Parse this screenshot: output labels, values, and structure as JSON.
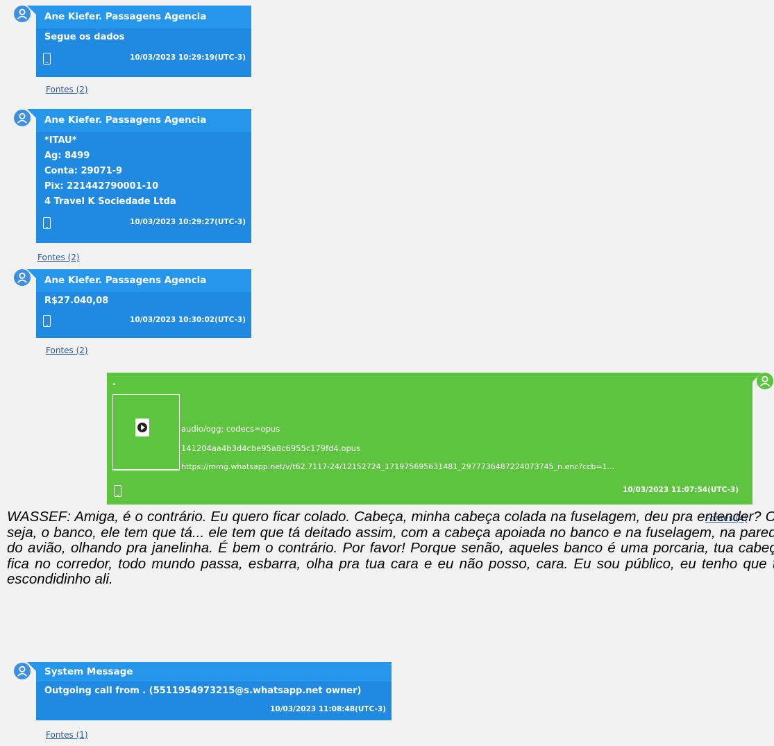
{
  "messages": [
    {
      "sender": "Ane Kiefer. Passagens Agencia",
      "lines": [
        "Segue os dados"
      ],
      "timestamp": "10/03/2023 10:29:19(UTC-3)",
      "sources": "Fontes (2)"
    },
    {
      "sender": "Ane Kiefer. Passagens Agencia",
      "lines": [
        "*ITAU*",
        "Ag: 8499",
        "Conta: 29071-9",
        "Pix: 221442790001-10",
        "4 Travel K Sociedade Ltda"
      ],
      "timestamp": "10/03/2023 10:29:27(UTC-3)",
      "sources": "Fontes (2)"
    },
    {
      "sender": "Ane Kiefer. Passagens Agencia",
      "lines": [
        "R$27.040,08"
      ],
      "timestamp": "10/03/2023 10:30:02(UTC-3)",
      "sources": "Fontes (2)"
    },
    {
      "sender": ".",
      "attachment": {
        "mime": "audio/ogg; codecs=opus",
        "filename": "141204aa4b3d4cbe95a8c6955c179fd4.opus",
        "url": "https://mmg.whatsapp.net/v/t62.7117-24/12152724_171975695631481_2977736487224073745_n.enc?ccb=1..."
      },
      "timestamp": "10/03/2023 11:07:54(UTC-3)",
      "sources": "Fontes (4)"
    },
    {
      "sender": "System Message",
      "lines": [
        "Outgoing call from . (5511954973215@s.whatsapp.net owner)"
      ],
      "timestamp": "10/03/2023 11:08:48(UTC-3)",
      "sources": "Fontes (1)"
    }
  ],
  "transcript": "WASSEF: Amiga, é o contrário. Eu quero ficar colado. Cabeça, minha cabeça colada na fuselagem, deu pra entender? Ou seja, o banco, ele tem que tá... ele tem que tá deitado assim, com a cabeça apoiada no banco e na fuselagem, na parede do avião, olhando pra janelinha. É bem o contrário. Por favor! Porque senão, aqueles banco é uma porcaria, tua cabeça fica no corredor, todo mundo passa, esbarra, olha pra tua cara e eu não posso, cara. Eu sou público, eu tenho que tá escondidinho ali.",
  "colors": {
    "blue_bubble": "#1f8ae0",
    "green_bubble": "#5ec33f",
    "link": "#2a5d9e"
  },
  "icons": [
    "user-avatar-icon",
    "phone-icon",
    "audio-file-icon"
  ]
}
